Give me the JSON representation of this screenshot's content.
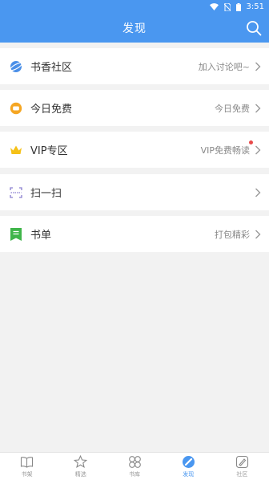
{
  "status": {
    "time": "3:51"
  },
  "header": {
    "title": "发现"
  },
  "items": [
    {
      "label": "书香社区",
      "hint": "加入讨论吧~",
      "icon": "planet-icon"
    },
    {
      "label": "今日免费",
      "hint": "今日免费",
      "icon": "coin-icon"
    },
    {
      "label": "VIP专区",
      "hint": "VIP免费畅读",
      "icon": "crown-icon"
    },
    {
      "label": "扫一扫",
      "hint": "",
      "icon": "scan-icon"
    },
    {
      "label": "书单",
      "hint": "打包精彩",
      "icon": "booklist-icon"
    }
  ],
  "tabs": [
    {
      "label": "书架",
      "icon": "bookshelf-icon"
    },
    {
      "label": "精选",
      "icon": "star-icon"
    },
    {
      "label": "书库",
      "icon": "library-icon"
    },
    {
      "label": "发现",
      "icon": "discover-icon",
      "active": true
    },
    {
      "label": "社区",
      "icon": "community-icon"
    }
  ],
  "colors": {
    "primary": "#4a97f0",
    "badge": "#e84b4b"
  }
}
